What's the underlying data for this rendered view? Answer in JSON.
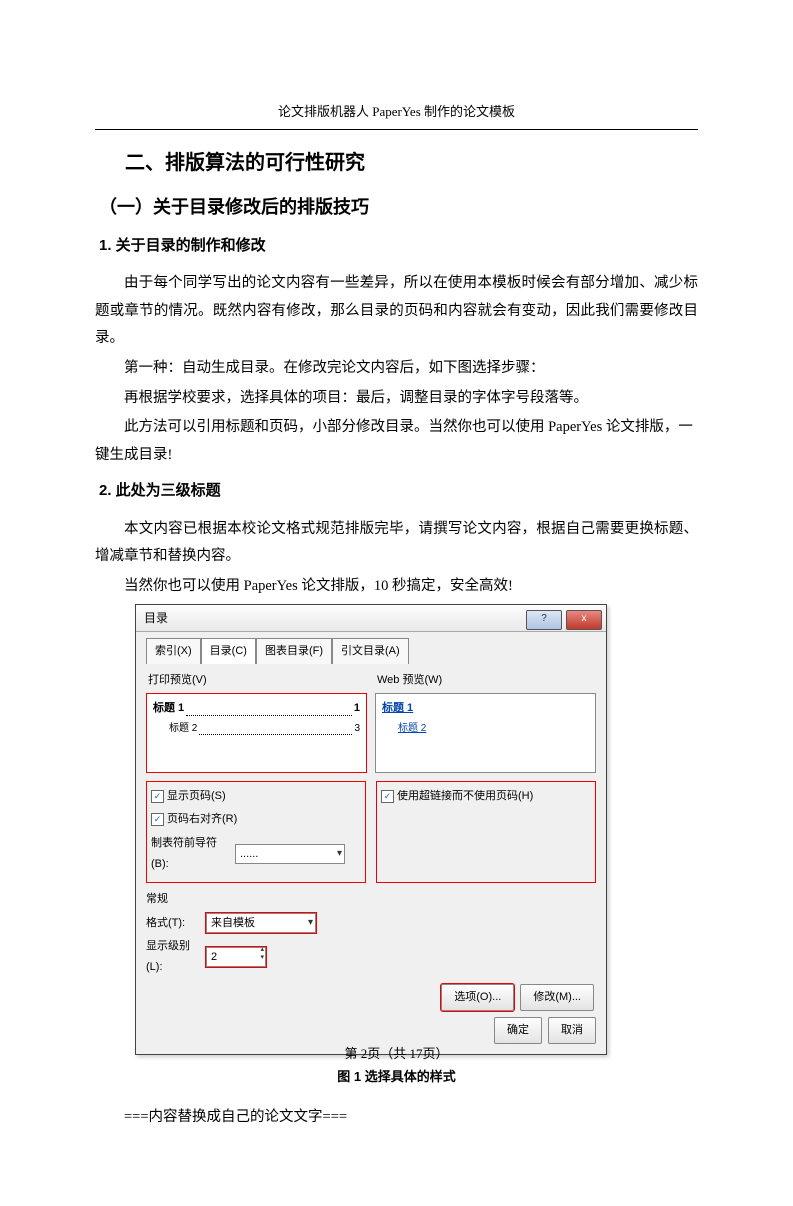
{
  "header": {
    "running": "论文排版机器人 PaperYes 制作的论文模板"
  },
  "h1": "二、排版算法的可行性研究",
  "h2": "（一）关于目录修改后的排版技巧",
  "h3_1": "1. 关于目录的制作和修改",
  "p1": "由于每个同学写出的论文内容有一些差异，所以在使用本模板时候会有部分增加、减少标题或章节的情况。既然内容有修改，那么目录的页码和内容就会有变动，因此我们需要修改目录。",
  "p2": "第一种：自动生成目录。在修改完论文内容后，如下图选择步骤：",
  "p3": "再根据学校要求，选择具体的项目：最后，调整目录的字体字号段落等。",
  "p4": "此方法可以引用标题和页码，小部分修改目录。当然你也可以使用 PaperYes 论文排版，一键生成目录!",
  "h3_2": "2. 此处为三级标题",
  "p5": "本文内容已根据本校论文格式规范排版完毕，请撰写论文内容，根据自己需要更换标题、增减章节和替换内容。",
  "p6": "当然你也可以使用 PaperYes 论文排版，10 秒搞定，安全高效!",
  "dialog": {
    "title": "目录",
    "help": "?",
    "close": "x",
    "tabs": [
      "索引(X)",
      "目录(C)",
      "图表目录(F)",
      "引文目录(A)"
    ],
    "print_preview_label": "打印预览(V)",
    "web_preview_label": "Web 预览(W)",
    "toc_h1": "标题 1",
    "toc_h1_page": "1",
    "toc_h2": "标题 2",
    "toc_h2_page": "3",
    "web_h1": "标题 1",
    "web_h2": "标题 2",
    "chk_show_page": "显示页码(S)",
    "chk_right_align": "页码右对齐(R)",
    "chk_hyperlink": "使用超链接而不使用页码(H)",
    "leader_label": "制表符前导符(B):",
    "leader_value": "......",
    "general_label": "常规",
    "format_label": "格式(T):",
    "format_value": "来自模板",
    "levels_label": "显示级别(L):",
    "levels_value": "2",
    "btn_options": "选项(O)...",
    "btn_modify": "修改(M)...",
    "btn_ok": "确定",
    "btn_cancel": "取消"
  },
  "caption": "图 1   选择具体的样式",
  "replace_line": "===内容替换成自己的论文文字===",
  "footer": "第 2页（共 17页）"
}
